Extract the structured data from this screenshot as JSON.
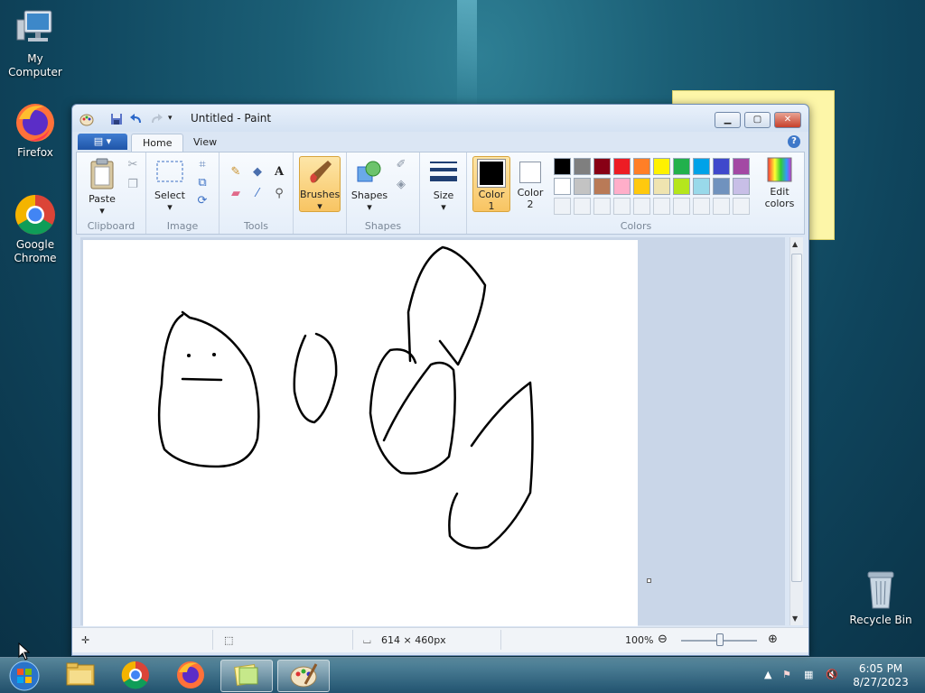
{
  "desktop": {
    "icons": [
      {
        "label": "My Computer",
        "icon": "computer-icon"
      },
      {
        "label": "Firefox",
        "icon": "firefox-icon"
      },
      {
        "label": "Google Chrome",
        "icon": "chrome-icon"
      },
      {
        "label": "Recycle Bin",
        "icon": "recycle-bin-icon"
      }
    ]
  },
  "window": {
    "title": "Untitled - Paint",
    "tabs": [
      "Home",
      "View"
    ],
    "groups": {
      "clipboard": {
        "label": "Clipboard",
        "paste": "Paste"
      },
      "image": {
        "label": "Image",
        "select": "Select"
      },
      "tools": {
        "label": "Tools"
      },
      "brushes": {
        "label": "Brushes"
      },
      "shapes": {
        "label": "Shapes",
        "shapes": "Shapes"
      },
      "size": {
        "label": "Size"
      },
      "colors": {
        "label": "Colors",
        "color1": "Color\n1",
        "color2": "Color\n2",
        "edit": "Edit\ncolors"
      }
    },
    "palette": {
      "row1": [
        "#000000",
        "#7f7f7f",
        "#880015",
        "#ed1c24",
        "#ff7f27",
        "#fff200",
        "#22b14c",
        "#00a2e8",
        "#3f48cc",
        "#a349a4"
      ],
      "row2": [
        "#ffffff",
        "#c3c3c3",
        "#b97a57",
        "#ffaec9",
        "#ffc90e",
        "#efe4b0",
        "#b5e61d",
        "#99d9ea",
        "#7092be",
        "#c8bfe7"
      ]
    },
    "status": {
      "size": "614 × 460px",
      "zoom": "100%"
    }
  },
  "taskbar": {
    "time": "6:05 PM",
    "date": "8/27/2023"
  }
}
